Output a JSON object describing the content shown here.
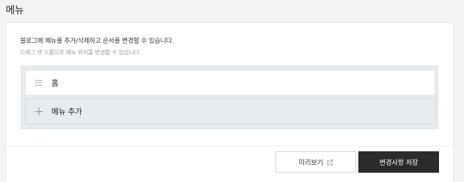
{
  "section": {
    "title": "메뉴"
  },
  "card": {
    "description": "블로그에 메뉴를 추가/삭제하고 순서를 변경할 수 있습니다.",
    "hint": "드래그 앤 드롭으로 메뉴 위치를 변경할 수 있습니다."
  },
  "menu": {
    "items": [
      {
        "label": "홈",
        "icon": "drag-handle-icon"
      }
    ],
    "add_label": "메뉴 추가",
    "add_icon": "plus-icon"
  },
  "footer": {
    "preview_label": "미리보기",
    "preview_icon": "external-link-icon",
    "save_label": "변경사항 저장"
  },
  "colors": {
    "save_button_bg": "#2b2b2b",
    "list_bg": "#e6ebef",
    "page_bg": "#f4f4f5"
  }
}
